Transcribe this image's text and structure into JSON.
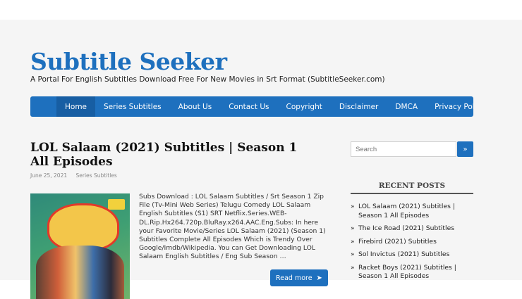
{
  "site": {
    "title": "Subtitle Seeker",
    "description": "A Portal For English Subtitles Download Free For New Movies in Srt Format (SubtitleSeeker.com)"
  },
  "nav": {
    "items": [
      {
        "label": "Home"
      },
      {
        "label": "Series Subtitles"
      },
      {
        "label": "About Us"
      },
      {
        "label": "Contact Us"
      },
      {
        "label": "Copyright"
      },
      {
        "label": "Disclaimer"
      },
      {
        "label": "DMCA"
      },
      {
        "label": "Privacy Policy"
      }
    ],
    "active_index": 0
  },
  "post": {
    "title": "LOL Salaam (2021) Subtitles | Season 1 All Episodes",
    "date": "June 25, 2021",
    "category": "Series Subtitles",
    "excerpt": "Subs Download : LOL Salaam Subtitles / Srt Season 1 Zip File (Tv-Mini Web Series) Telugu Comedy LOL Salaam English Subtitles (S1) SRT Netflix.Series.WEB-DL.Rip.Hx264.720p.BluRay.x264.AAC.Eng.Subs: In here your Favorite Movie/Series LOL Salaam (2021) (Season 1) Subtitles Complete All Episodes Which is Trendy Over Google/Imdb/Wikipedia. You can Get Downloading LOL Salaam English Subtitles / Eng Sub Season …",
    "read_more_label": "Read more",
    "read_more_icon": "arrow-right-icon"
  },
  "sidebar": {
    "search_placeholder": "Search",
    "search_button_glyph": "»",
    "recent_heading": "RECENT POSTS",
    "recent_posts": [
      {
        "title": "LOL Salaam (2021) Subtitles | Season 1 All Episodes"
      },
      {
        "title": "The Ice Road (2021) Subtitles"
      },
      {
        "title": "Firebird (2021) Subtitles"
      },
      {
        "title": "Sol Invictus (2021) Subtitles"
      },
      {
        "title": "Racket Boys (2021) Subtitles | Season 1 All Episodes"
      }
    ],
    "bullet_glyph": "»"
  },
  "colors": {
    "brand": "#1e70be",
    "nav_active": "#175ea3",
    "page_background": "#f5f5f5"
  }
}
